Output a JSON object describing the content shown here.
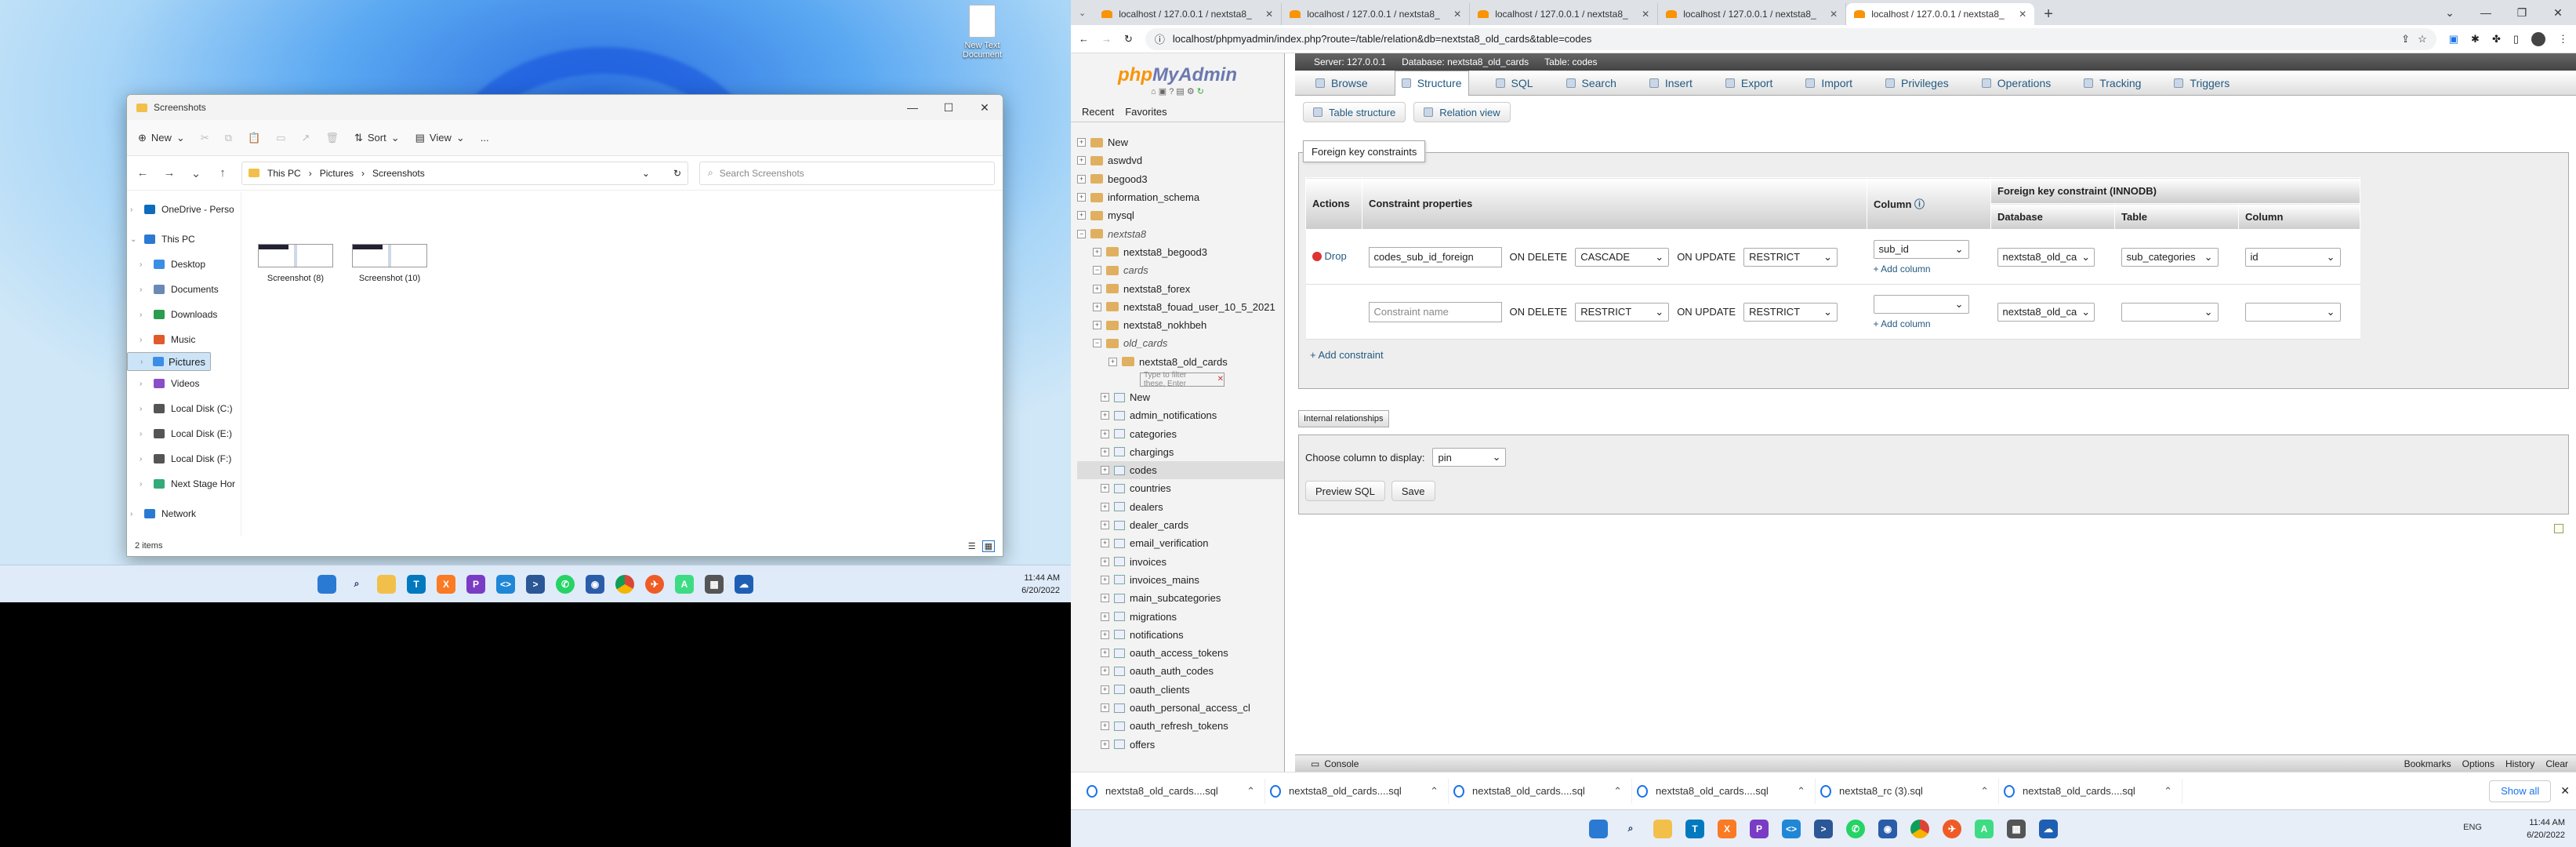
{
  "left_desktop": {
    "desktop_icon": {
      "label": "New Text Document",
      "icon": "text-file-icon"
    },
    "explorer": {
      "title": "Screenshots",
      "toolbar": {
        "new": "New",
        "sort": "Sort",
        "view": "View",
        "more": "..."
      },
      "breadcrumb": [
        "This PC",
        "Pictures",
        "Screenshots"
      ],
      "search_placeholder": "Search Screenshots",
      "nav_items": [
        {
          "label": "OneDrive - Perso",
          "icon": "cloud-icon",
          "color": "#0f6cbd"
        },
        {
          "label": "This PC",
          "icon": "pc-icon",
          "color": "#2a7ad3"
        },
        {
          "label": "Desktop",
          "icon": "desktop-icon",
          "color": "#3a8ee6"
        },
        {
          "label": "Documents",
          "icon": "documents-icon",
          "color": "#6a8ab5"
        },
        {
          "label": "Downloads",
          "icon": "download-icon",
          "color": "#2a9d4e"
        },
        {
          "label": "Music",
          "icon": "music-icon",
          "color": "#e05a2b"
        },
        {
          "label": "Pictures",
          "icon": "pictures-icon",
          "color": "#3a8ee6"
        },
        {
          "label": "Videos",
          "icon": "videos-icon",
          "color": "#8a4fc7"
        },
        {
          "label": "Local Disk (C:)",
          "icon": "drive-icon",
          "color": "#555"
        },
        {
          "label": "Local Disk (E:)",
          "icon": "drive-icon",
          "color": "#555"
        },
        {
          "label": "Local Disk (F:)",
          "icon": "drive-icon",
          "color": "#555"
        },
        {
          "label": "Next Stage Hor",
          "icon": "drive-icon",
          "color": "#3a7"
        },
        {
          "label": "Network",
          "icon": "network-icon",
          "color": "#2a7ad3"
        }
      ],
      "files": [
        {
          "name": "Screenshot (8)"
        },
        {
          "name": "Screenshot (10)"
        }
      ],
      "status": "2 items"
    },
    "clock": {
      "time": "11:44 AM",
      "date": "6/20/2022"
    }
  },
  "browser": {
    "tabs": [
      {
        "title": "localhost / 127.0.0.1 / nextsta8_o..."
      },
      {
        "title": "localhost / 127.0.0.1 / nextsta8_..."
      },
      {
        "title": "localhost / 127.0.0.1 / nextsta8_..."
      },
      {
        "title": "localhost / 127.0.0.1 / nextsta8_o..."
      },
      {
        "title": "localhost / 127.0.0.1 / nextsta8_o..."
      }
    ],
    "url": "localhost/phpmyadmin/index.php?route=/table/relation&db=nextsta8_old_cards&table=codes"
  },
  "pma": {
    "logo_php": "php",
    "logo_myadmin": "MyAdmin",
    "nav_tabs": [
      "Recent",
      "Favorites"
    ],
    "tree": [
      {
        "label": "New",
        "lvl": 0,
        "kind": "new"
      },
      {
        "label": "aswdvd",
        "lvl": 0,
        "kind": "db"
      },
      {
        "label": "begood3",
        "lvl": 0,
        "kind": "db"
      },
      {
        "label": "information_schema",
        "lvl": 0,
        "kind": "db"
      },
      {
        "label": "mysql",
        "lvl": 0,
        "kind": "db"
      },
      {
        "label": "nextsta8",
        "lvl": 0,
        "kind": "group"
      },
      {
        "label": "nextsta8_begood3",
        "lvl": 1,
        "kind": "db"
      },
      {
        "label": "cards",
        "lvl": 1,
        "kind": "group"
      },
      {
        "label": "nextsta8_forex",
        "lvl": 1,
        "kind": "db"
      },
      {
        "label": "nextsta8_fouad_user_10_5_2021",
        "lvl": 1,
        "kind": "db"
      },
      {
        "label": "nextsta8_nokhbeh",
        "lvl": 1,
        "kind": "db"
      },
      {
        "label": "old_cards",
        "lvl": 1,
        "kind": "group"
      },
      {
        "label": "nextsta8_old_cards",
        "lvl": 2,
        "kind": "db"
      }
    ],
    "filter_placeholder": "Type to filter these, Enter",
    "tables": [
      "New",
      "admin_notifications",
      "categories",
      "chargings",
      "codes",
      "countries",
      "dealers",
      "dealer_cards",
      "email_verification",
      "invoices",
      "invoices_mains",
      "main_subcategories",
      "migrations",
      "notifications",
      "oauth_access_tokens",
      "oauth_auth_codes",
      "oauth_clients",
      "oauth_personal_access_cl",
      "oauth_refresh_tokens",
      "offers"
    ],
    "breadcrumb": [
      "Server: 127.0.0.1",
      "Database: nextsta8_old_cards",
      "Table: codes"
    ],
    "top_menu": [
      "Browse",
      "Structure",
      "SQL",
      "Search",
      "Insert",
      "Export",
      "Import",
      "Privileges",
      "Operations",
      "Tracking",
      "Triggers"
    ],
    "sub_nav": [
      "Table structure",
      "Relation view"
    ],
    "fk_legend": "Foreign key constraints",
    "fk_headers": {
      "actions": "Actions",
      "props": "Constraint properties",
      "column": "Column",
      "fk": "Foreign key constraint (INNODB)",
      "database": "Database",
      "table": "Table",
      "col2": "Column"
    },
    "rows": [
      {
        "drop": "Drop",
        "name": "codes_sub_id_foreign",
        "on_delete_label": "ON DELETE",
        "on_delete": "CASCADE",
        "on_update_label": "ON UPDATE",
        "on_update": "RESTRICT",
        "column": "sub_id",
        "add_column": "+ Add column",
        "database": "nextsta8_old_ca",
        "table": "sub_categories",
        "ref_column": "id"
      },
      {
        "name_placeholder": "Constraint name",
        "on_delete_label": "ON DELETE",
        "on_delete": "RESTRICT",
        "on_update_label": "ON UPDATE",
        "on_update": "RESTRICT",
        "column": "",
        "add_column": "+ Add column",
        "database": "nextsta8_old_ca",
        "table": "",
        "ref_column": ""
      }
    ],
    "add_constraint": "+ Add constraint",
    "internal_relationships": "Internal relationships",
    "display_label": "Choose column to display:",
    "display_value": "pin",
    "preview_sql": "Preview SQL",
    "save": "Save",
    "console": "Console",
    "console_right": [
      "Bookmarks",
      "Options",
      "History",
      "Clear"
    ]
  },
  "downloads": {
    "items": [
      "nextsta8_old_cards....sql",
      "nextsta8_old_cards....sql",
      "nextsta8_old_cards....sql",
      "nextsta8_old_cards....sql",
      "nextsta8_rc (3).sql",
      "nextsta8_old_cards....sql"
    ],
    "show_all": "Show all"
  },
  "right_clock": {
    "time": "11:44 AM",
    "date": "6/20/2022",
    "lang": "ENG"
  }
}
